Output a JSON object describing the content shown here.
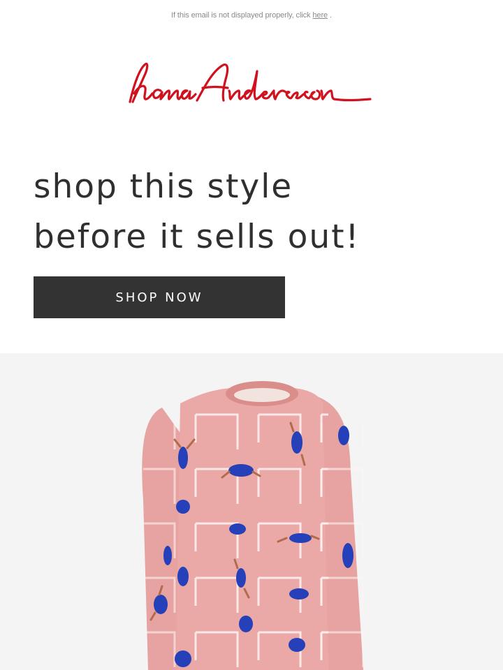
{
  "preheader": {
    "text": "If this email is not displayed properly, click",
    "link_label": "here",
    "trail": " ."
  },
  "brand": {
    "logo_text": "hanna andersson",
    "color": "#d0121f"
  },
  "headline": {
    "line1": "shop this style",
    "line2": "before it sells out!"
  },
  "cta": {
    "label": "SHOP NOW"
  },
  "hero": {
    "image": "pink-long-sleeve-pajama-top-with-blue-cat-print"
  },
  "colors": {
    "text_dark": "#2f2f2f",
    "button_bg": "#333333",
    "sweater_pink": "#e8a7a4",
    "print_blue": "#2540b8"
  }
}
